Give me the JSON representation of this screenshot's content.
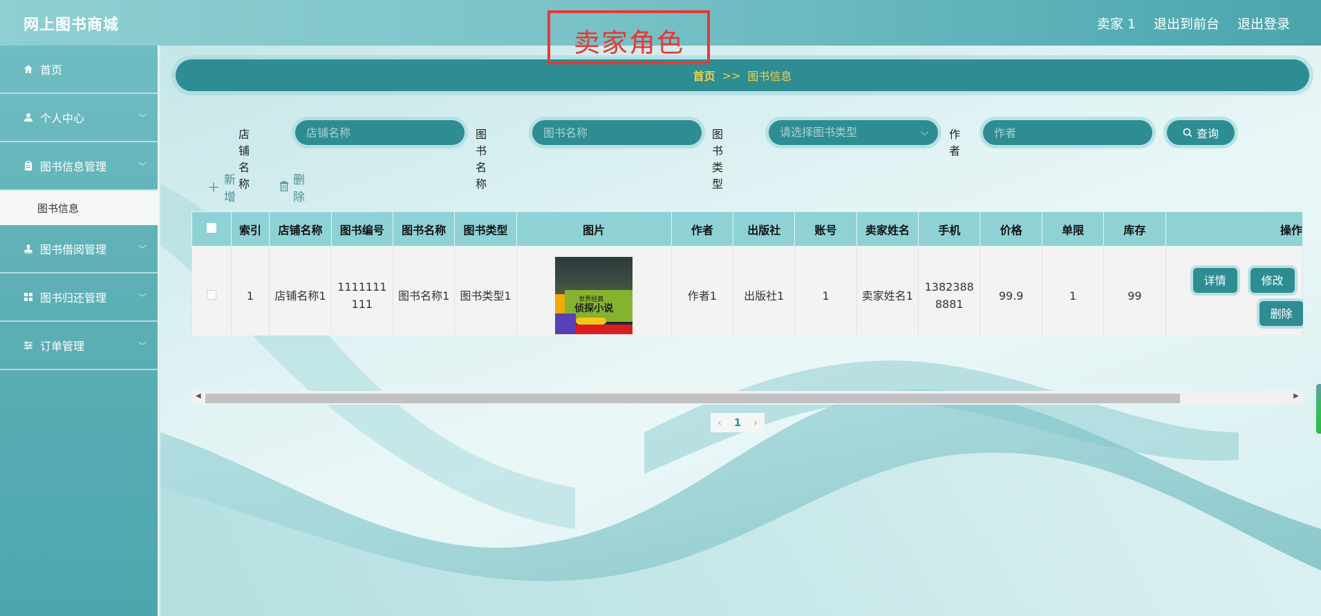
{
  "header": {
    "brand": "网上图书商城",
    "role_annotation": "卖家角色",
    "user_label": "卖家 1",
    "back_front_label": "退出到前台",
    "logout_label": "退出登录"
  },
  "sidebar": {
    "items": [
      {
        "label": "首页",
        "icon": "home-icon"
      },
      {
        "label": "个人中心",
        "icon": "user-icon"
      },
      {
        "label": "图书信息管理",
        "icon": "clipboard-icon",
        "submenu": "图书信息"
      },
      {
        "label": "图书借阅管理",
        "icon": "stamp-icon"
      },
      {
        "label": "图书归还管理",
        "icon": "grid-icon"
      },
      {
        "label": "订单管理",
        "icon": "sliders-icon"
      }
    ]
  },
  "breadcrumb": {
    "home": "首页",
    "separator": ">>",
    "current": "图书信息"
  },
  "search": {
    "shop_label": "店铺名称",
    "shop_placeholder": "店铺名称",
    "book_label": "图书名称",
    "book_placeholder": "图书名称",
    "type_label": "图书类型",
    "type_placeholder": "请选择图书类型",
    "author_label": "作者",
    "author_placeholder": "作者",
    "query_label": "查询"
  },
  "actions": {
    "add_label": "新增",
    "delete_label": "删除"
  },
  "table": {
    "headers": [
      "索引",
      "店铺名称",
      "图书编号",
      "图书名称",
      "图书类型",
      "图片",
      "作者",
      "出版社",
      "账号",
      "卖家姓名",
      "手机",
      "价格",
      "单限",
      "库存",
      "操作"
    ],
    "rows": [
      {
        "index": "1",
        "shop": "店铺名称1",
        "book_no": "1111111111",
        "book_name": "图书名称1",
        "book_type": "图书类型1",
        "cover_line1": "世界经典",
        "cover_line2": "侦探小说",
        "author": "作者1",
        "publisher": "出版社1",
        "account": "1",
        "seller_name": "卖家姓名1",
        "phone": "13823888881",
        "price": "99.9",
        "limit": "1",
        "stock": "99"
      }
    ],
    "op_detail": "详情",
    "op_edit": "修改",
    "op_delete": "删除"
  },
  "pagination": {
    "prev": "‹",
    "current": "1",
    "next": "›"
  },
  "colors": {
    "primary": "#2e8d92",
    "header_row": "#8fd2d6",
    "breadcrumb_text": "#f3d24a",
    "annotation": "#e53935"
  }
}
